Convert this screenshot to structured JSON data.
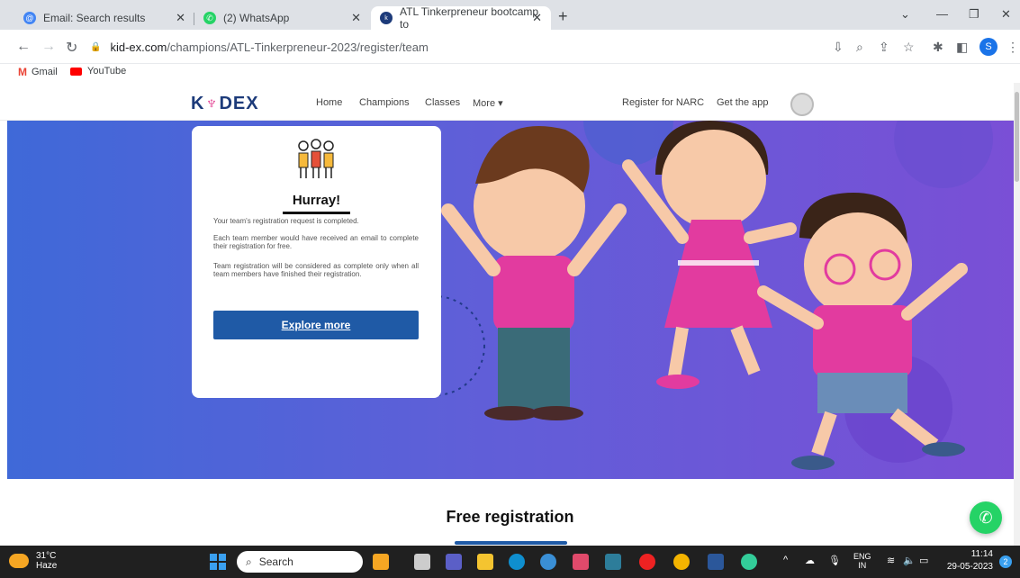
{
  "browser": {
    "tabs": [
      {
        "title": "Email: Search results",
        "icon": "email-icon",
        "color": "#4285f4"
      },
      {
        "title": "(2) WhatsApp",
        "icon": "whatsapp-icon",
        "color": "#25d366"
      },
      {
        "title": "ATL Tinkerpreneur bootcamp to",
        "icon": "kidex-icon",
        "color": "#1d3b7a"
      }
    ],
    "new_tab": "+",
    "url_domain": "kid-ex.com",
    "url_path": "/champions/ATL-Tinkerpreneur-2023/register/team",
    "profile_initial": "S",
    "bookmarks": [
      {
        "label": "Gmail",
        "icon": "gmail-icon"
      },
      {
        "label": "YouTube",
        "icon": "youtube-icon"
      }
    ]
  },
  "site": {
    "logo_k": "K",
    "logo_rest": "DEX",
    "nav": {
      "home": "Home",
      "champions": "Champions",
      "classes": "Classes",
      "more": "More ▾",
      "register": "Register for NARC",
      "get_app": "Get the app"
    }
  },
  "card": {
    "title": "Hurray!",
    "line1": "Your team's registration request is completed.",
    "line2": "Each team member would have received an email to complete their registration for free.",
    "line3": "Team registration will be considered as complete only when all team members have finished their registration.",
    "button": "Explore more"
  },
  "section": {
    "title": "Free registration"
  },
  "taskbar": {
    "temp": "31°C",
    "weather": "Haze",
    "search_placeholder": "Search",
    "lang": "ENG",
    "region": "IN",
    "time": "11:14",
    "date": "29-05-2023",
    "notif_count": "2"
  },
  "colors": {
    "accent": "#1f5aa6",
    "hero_start": "#3f69d8",
    "hero_end": "#7a4fd6",
    "shirt": "#e23b9f"
  }
}
